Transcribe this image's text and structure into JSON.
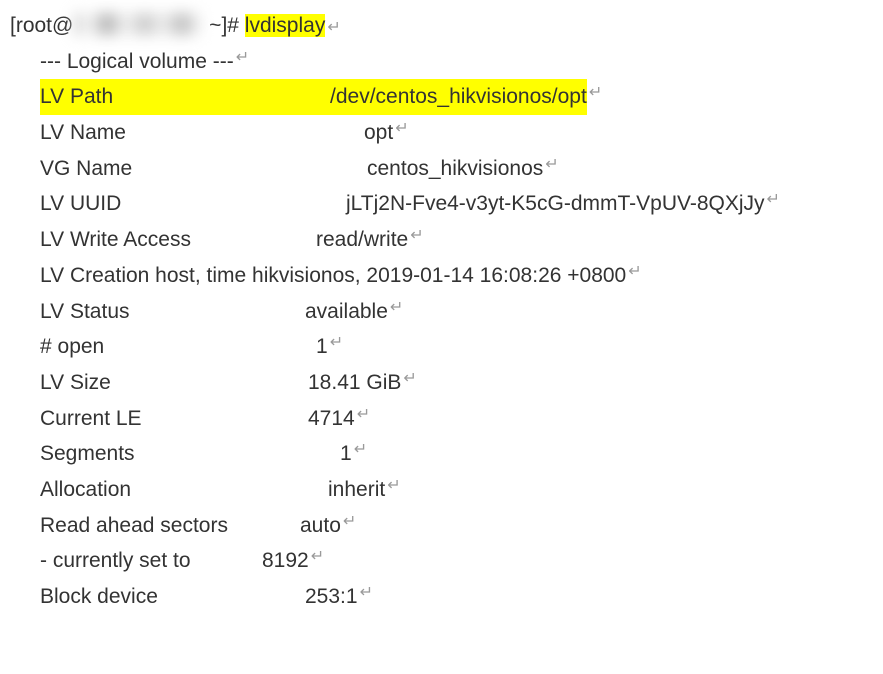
{
  "prompt": {
    "prefix": "[root@",
    "suffix": " ~]# ",
    "command": "lvdisplay"
  },
  "header": "--- Logical volume ---",
  "fields": {
    "lv_path": {
      "label": "LV Path",
      "value": "/dev/centos_hikvisionos/opt"
    },
    "lv_name": {
      "label": "LV Name",
      "value": "opt"
    },
    "vg_name": {
      "label": "VG Name",
      "value": "centos_hikvisionos"
    },
    "lv_uuid": {
      "label": "LV UUID",
      "value": "jLTj2N-Fve4-v3yt-K5cG-dmmT-VpUV-8QXjJy"
    },
    "lv_write_access": {
      "label": "LV Write Access",
      "value": "read/write"
    },
    "lv_creation": {
      "text": "LV Creation host, time hikvisionos, 2019-01-14 16:08:26 +0800"
    },
    "lv_status": {
      "label": "LV Status",
      "value": "available"
    },
    "open": {
      "label": "# open",
      "value": "1"
    },
    "lv_size": {
      "label": "LV Size",
      "value": "18.41 GiB"
    },
    "current_le": {
      "label": "Current LE",
      "value": "4714"
    },
    "segments": {
      "label": "Segments",
      "value": "1"
    },
    "allocation": {
      "label": "Allocation",
      "value": "inherit"
    },
    "read_ahead": {
      "label": "Read ahead sectors",
      "value": "auto"
    },
    "currently_set_to": {
      "label": "- currently set to",
      "value": "8192"
    },
    "block_device": {
      "label": "Block device",
      "value": "253:1"
    }
  },
  "eol_glyph": "↵"
}
